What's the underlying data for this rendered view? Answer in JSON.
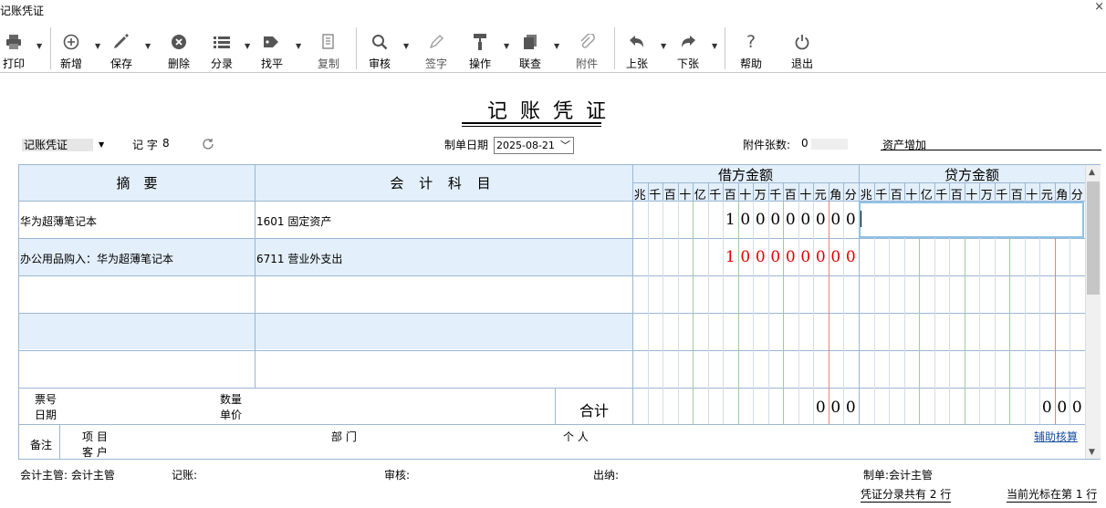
{
  "window": {
    "title": "记账凭证",
    "close_glyph": "×"
  },
  "toolbar": {
    "print": "打印",
    "add": "新增",
    "save": "保存",
    "delete": "删除",
    "split": "分录",
    "balance": "找平",
    "copy": "复制",
    "audit": "审核",
    "sign": "签字",
    "operate": "操作",
    "query": "联查",
    "attach": "附件",
    "prev": "上张",
    "next": "下张",
    "help": "帮助",
    "exit": "退出"
  },
  "voucher": {
    "title": "记账凭证",
    "type": "记账凭证",
    "word_label": "记 字",
    "word_number": "8",
    "date_label": "制单日期",
    "date": "2025-08-21",
    "attach_label": "附件张数:",
    "attach_count": "0",
    "memo": "资产增加"
  },
  "table": {
    "col_summary": "摘　要",
    "col_account": "会 计 科 目",
    "col_debit": "借方金额",
    "col_credit": "贷方金额",
    "units": [
      "兆",
      "千",
      "百",
      "十",
      "亿",
      "千",
      "百",
      "十",
      "万",
      "千",
      "百",
      "十",
      "元",
      "角",
      "分"
    ],
    "rows": [
      {
        "summary": "华为超薄笔记本",
        "account": "1601 固定资产",
        "debit": "100000000",
        "credit": ""
      },
      {
        "summary": "办公用品购入：华为超薄笔记本",
        "account": "6711 营业外支出",
        "debit": "100000000",
        "credit": ""
      },
      {
        "summary": "",
        "account": "",
        "debit": "",
        "credit": ""
      },
      {
        "summary": "",
        "account": "",
        "debit": "",
        "credit": ""
      },
      {
        "summary": "",
        "account": "",
        "debit": "",
        "credit": ""
      }
    ],
    "footer": {
      "ticket_no": "票号",
      "date": "日期",
      "quantity": "数量",
      "price": "单价",
      "total_label": "合计",
      "debit_total": "000",
      "credit_total": "000"
    },
    "remark": {
      "label": "备注",
      "project": "项 目",
      "customer": "客 户",
      "dept": "部 门",
      "person": "个 人",
      "aux_button": "辅助核算"
    }
  },
  "signatures": {
    "supervisor": "会计主管: 会计主管",
    "bookkeeper": "记账:",
    "auditor": "审核:",
    "cashier": "出纳:",
    "preparer": "制单:会计主管"
  },
  "status": {
    "entries": "凭证分录共有 2 行",
    "cursor": "当前光标在第 1 行"
  },
  "colors": {
    "grid_blue": "#9bb7d4",
    "header_fill": "#e3effa",
    "red_amount": "#e00000",
    "focus": "#8fc3e6"
  }
}
